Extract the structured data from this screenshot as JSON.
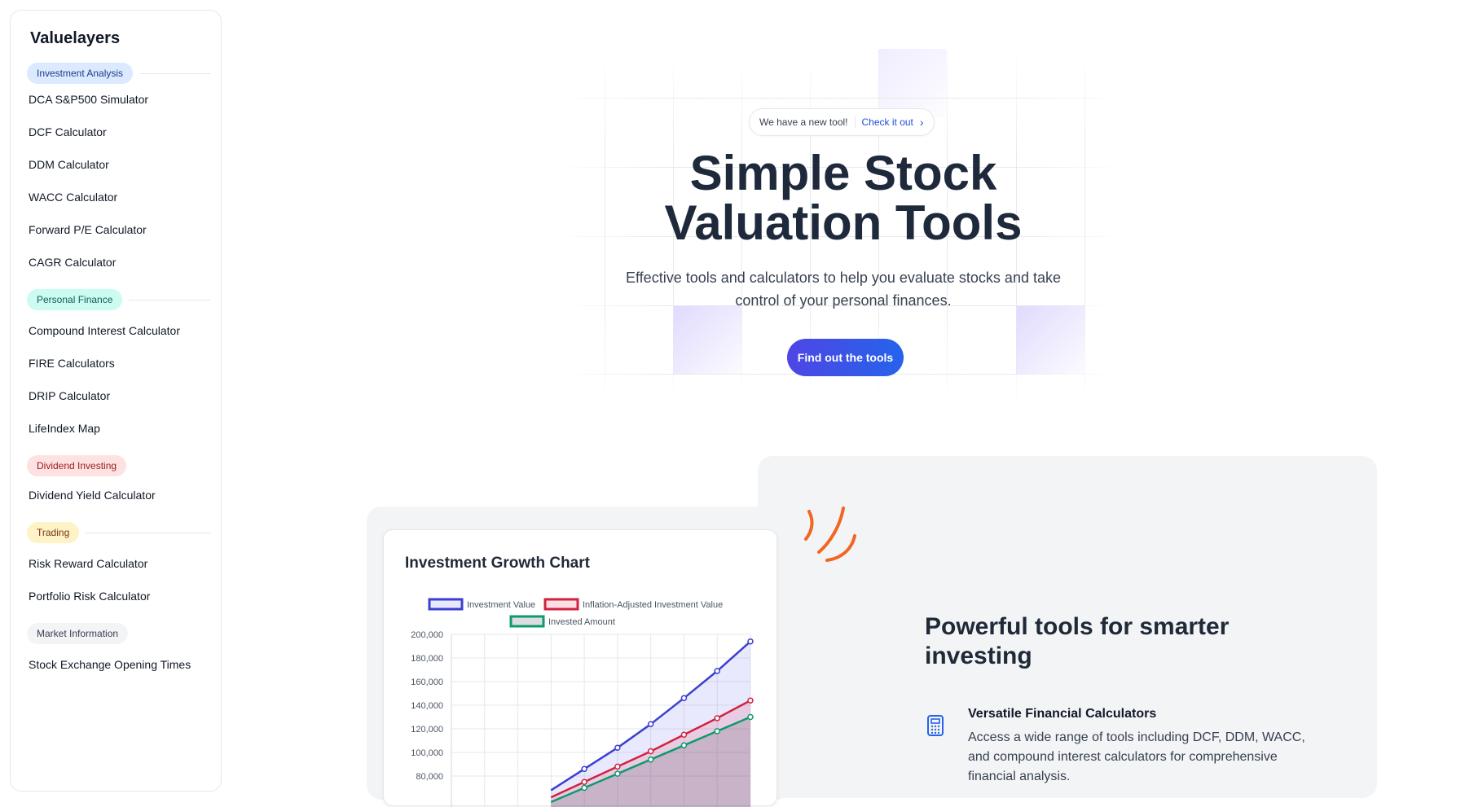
{
  "sidebar": {
    "brand": "Valuelayers",
    "sections": [
      {
        "label": "Investment Analysis",
        "items": [
          "DCA S&P500 Simulator",
          "DCF Calculator",
          "DDM Calculator",
          "WACC Calculator",
          "Forward P/E Calculator",
          "CAGR Calculator"
        ]
      },
      {
        "label": "Personal Finance",
        "items": [
          "Compound Interest Calculator",
          "FIRE Calculators",
          "DRIP Calculator",
          "LifeIndex Map"
        ]
      },
      {
        "label": "Dividend Investing",
        "items": [
          "Dividend Yield Calculator"
        ]
      },
      {
        "label": "Trading",
        "items": [
          "Risk Reward Calculator",
          "Portfolio Risk Calculator"
        ]
      },
      {
        "label": "Market Information",
        "items": [
          "Stock Exchange Opening Times"
        ]
      }
    ]
  },
  "hero": {
    "badge_text": "We have a new tool!",
    "badge_link": "Check it out",
    "title": "Simple Stock Valuation Tools",
    "subtitle": "Effective tools and calculators to help you evaluate stocks and take control of your personal finances.",
    "cta": "Find out the tools"
  },
  "features": {
    "title": "Powerful tools for smarter investing",
    "item_title": "Versatile Financial Calculators",
    "item_desc": "Access a wide range of tools including DCF, DDM, WACC, and compound interest calculators for comprehensive financial analysis."
  },
  "colors": {
    "accent": "#4f46e5",
    "series_investment": "#3b3fd1",
    "series_inflation": "#d1233f",
    "series_invested": "#0e9a6b",
    "squiggle": "#f26522"
  },
  "chart_data": {
    "type": "line",
    "title": "Investment Growth Chart",
    "ylim": [
      0,
      200000
    ],
    "yticks": [
      80000,
      100000,
      120000,
      140000,
      160000,
      180000,
      200000
    ],
    "ytick_labels": [
      "80,000",
      "100,000",
      "120,000",
      "140,000",
      "160,000",
      "180,000",
      "200,000"
    ],
    "legend_position": "top",
    "grid": true,
    "series": [
      {
        "name": "Investment Value",
        "values": [
          null,
          null,
          null,
          null,
          86000,
          104000,
          124000,
          146000,
          169000,
          194000
        ]
      },
      {
        "name": "Inflation-Adjusted Investment Value",
        "values": [
          null,
          null,
          null,
          null,
          75000,
          88000,
          101000,
          115000,
          129000,
          144000
        ]
      },
      {
        "name": "Invested Amount",
        "values": [
          null,
          null,
          null,
          null,
          70000,
          82000,
          94000,
          106000,
          118000,
          130000
        ]
      }
    ]
  }
}
